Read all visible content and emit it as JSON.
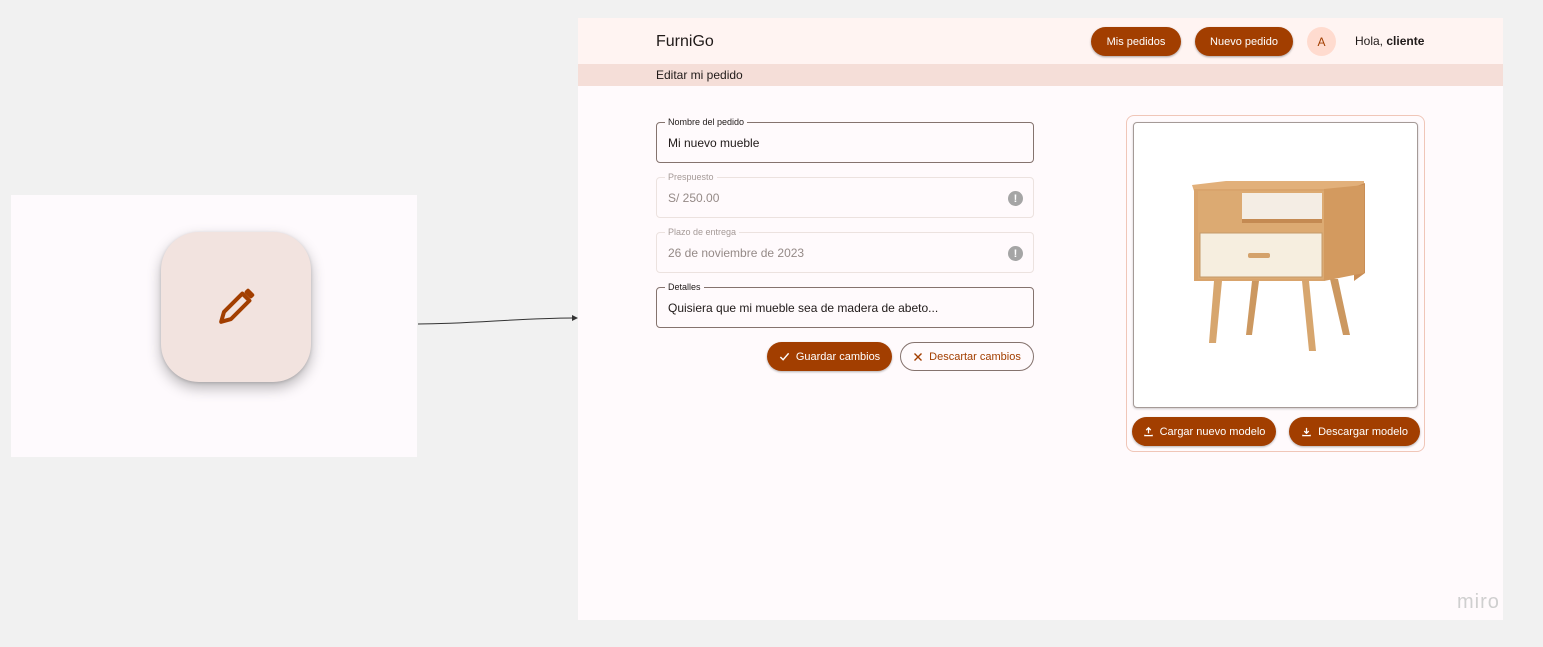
{
  "app": {
    "brand": "FurniGo",
    "greeting_prefix": "Hola, ",
    "greeting_name": "cliente",
    "avatar_initial": "A"
  },
  "nav": {
    "orders_label": "Mis pedidos",
    "new_order_label": "Nuevo pedido"
  },
  "page": {
    "title": "Editar mi pedido"
  },
  "form": {
    "name": {
      "label": "Nombre del pedido",
      "value": "Mi nuevo mueble"
    },
    "budget": {
      "label": "Prespuesto",
      "value": "S/ 250.00"
    },
    "deadline": {
      "label": "Plazo de entrega",
      "value": "26 de noviembre de 2023"
    },
    "details": {
      "label": "Detalles",
      "value": "Quisiera que mi mueble sea de madera de abeto..."
    },
    "save_label": "Guardar cambios",
    "discard_label": "Descartar cambios"
  },
  "model": {
    "upload_label": "Cargar nuevo modelo",
    "download_label": "Descargar modelo"
  },
  "watermark": "miro",
  "colors": {
    "primary": "#a23e00",
    "surface": "#fffafc",
    "appbar": "#fff4f2",
    "subbar": "#f5ded8",
    "tile": "#f2e3df"
  },
  "icons": {
    "tile": "pencil-icon",
    "save": "check-icon",
    "discard": "close-icon",
    "upload": "upload-icon",
    "download": "download-icon",
    "info": "alert-circle-icon"
  }
}
